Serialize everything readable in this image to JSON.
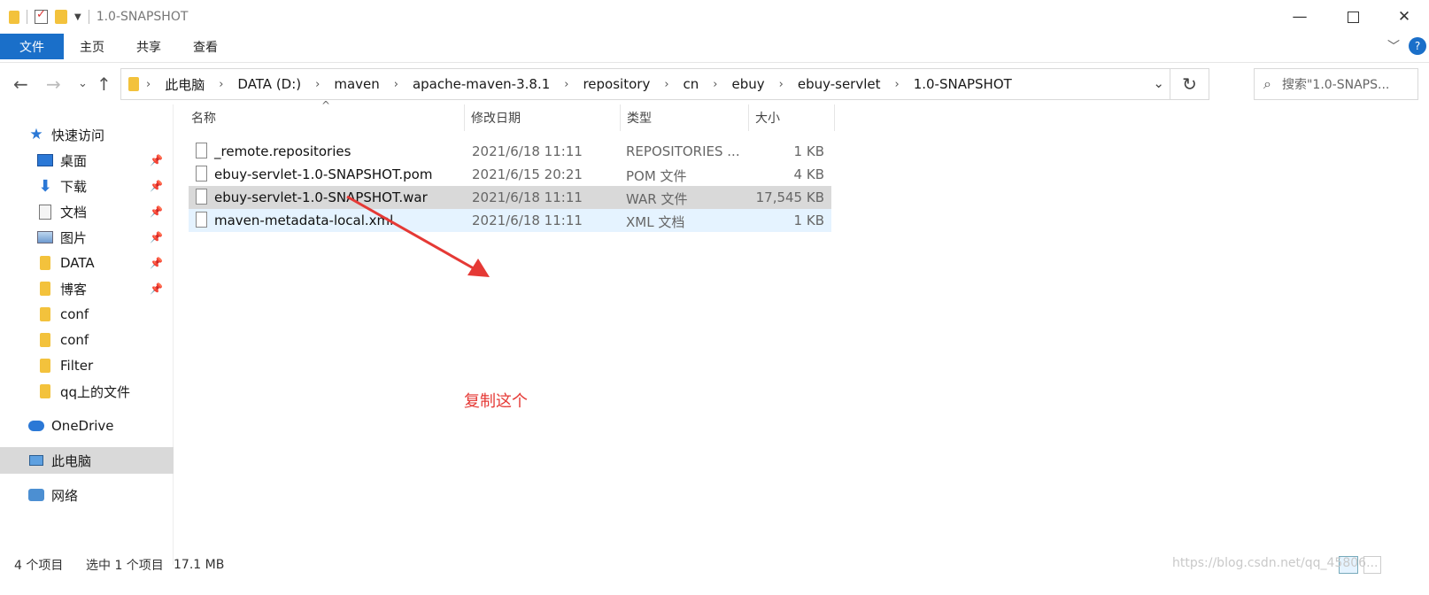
{
  "titlebar": {
    "title": "1.0-SNAPSHOT",
    "controls": {
      "minimize": "—",
      "close": "✕"
    }
  },
  "ribbon": {
    "tabs": [
      "文件",
      "主页",
      "共享",
      "查看"
    ],
    "expand": "﹀",
    "help": "?"
  },
  "nav": {
    "back": "←",
    "forward": "→",
    "recent": "⌄",
    "up": "↑"
  },
  "address": {
    "breadcrumbs": [
      "此电脑",
      "DATA (D:)",
      "maven",
      "apache-maven-3.8.1",
      "repository",
      "cn",
      "ebuy",
      "ebuy-servlet",
      "1.0-SNAPSHOT"
    ],
    "separator": "›",
    "dropdown": "⌄",
    "refresh": "↻"
  },
  "search": {
    "placeholder": "搜索\"1.0-SNAPS...",
    "icon": "⌕"
  },
  "sidebar": {
    "quick_access": "快速访问",
    "items": [
      {
        "label": "桌面",
        "icon": "desktop-icon",
        "pinned": true
      },
      {
        "label": "下载",
        "icon": "download-icon",
        "pinned": true
      },
      {
        "label": "文档",
        "icon": "document-icon",
        "pinned": true
      },
      {
        "label": "图片",
        "icon": "picture-icon",
        "pinned": true
      },
      {
        "label": "DATA",
        "icon": "folder-icon",
        "pinned": true
      },
      {
        "label": "博客",
        "icon": "folder-icon",
        "pinned": true
      },
      {
        "label": "conf",
        "icon": "folder-icon",
        "pinned": false
      },
      {
        "label": "conf",
        "icon": "folder-icon",
        "pinned": false
      },
      {
        "label": "Filter",
        "icon": "folder-icon",
        "pinned": false
      },
      {
        "label": "qq上的文件",
        "icon": "folder-icon",
        "pinned": false
      }
    ],
    "onedrive": "OneDrive",
    "this_pc": "此电脑",
    "network": "网络",
    "pin_glyph": "📌"
  },
  "filelist": {
    "columns": {
      "name": "名称",
      "date": "修改日期",
      "type": "类型",
      "size": "大小"
    },
    "sort_glyph": "^",
    "rows": [
      {
        "name": "_remote.repositories",
        "date": "2021/6/18 11:11",
        "type": "REPOSITORIES ...",
        "size": "1 KB"
      },
      {
        "name": "ebuy-servlet-1.0-SNAPSHOT.pom",
        "date": "2021/6/15 20:21",
        "type": "POM 文件",
        "size": "4 KB"
      },
      {
        "name": "ebuy-servlet-1.0-SNAPSHOT.war",
        "date": "2021/6/18 11:11",
        "type": "WAR 文件",
        "size": "17,545 KB"
      },
      {
        "name": "maven-metadata-local.xml",
        "date": "2021/6/18 11:11",
        "type": "XML 文档",
        "size": "1 KB"
      }
    ],
    "selected_row": 2,
    "hover_row": 3
  },
  "annotation": {
    "text": "复制这个",
    "color": "#e53935"
  },
  "status": {
    "count": "4 个项目",
    "selected": "选中 1 个项目",
    "size": "17.1 MB"
  },
  "watermark": "https://blog.csdn.net/qq_45806..."
}
